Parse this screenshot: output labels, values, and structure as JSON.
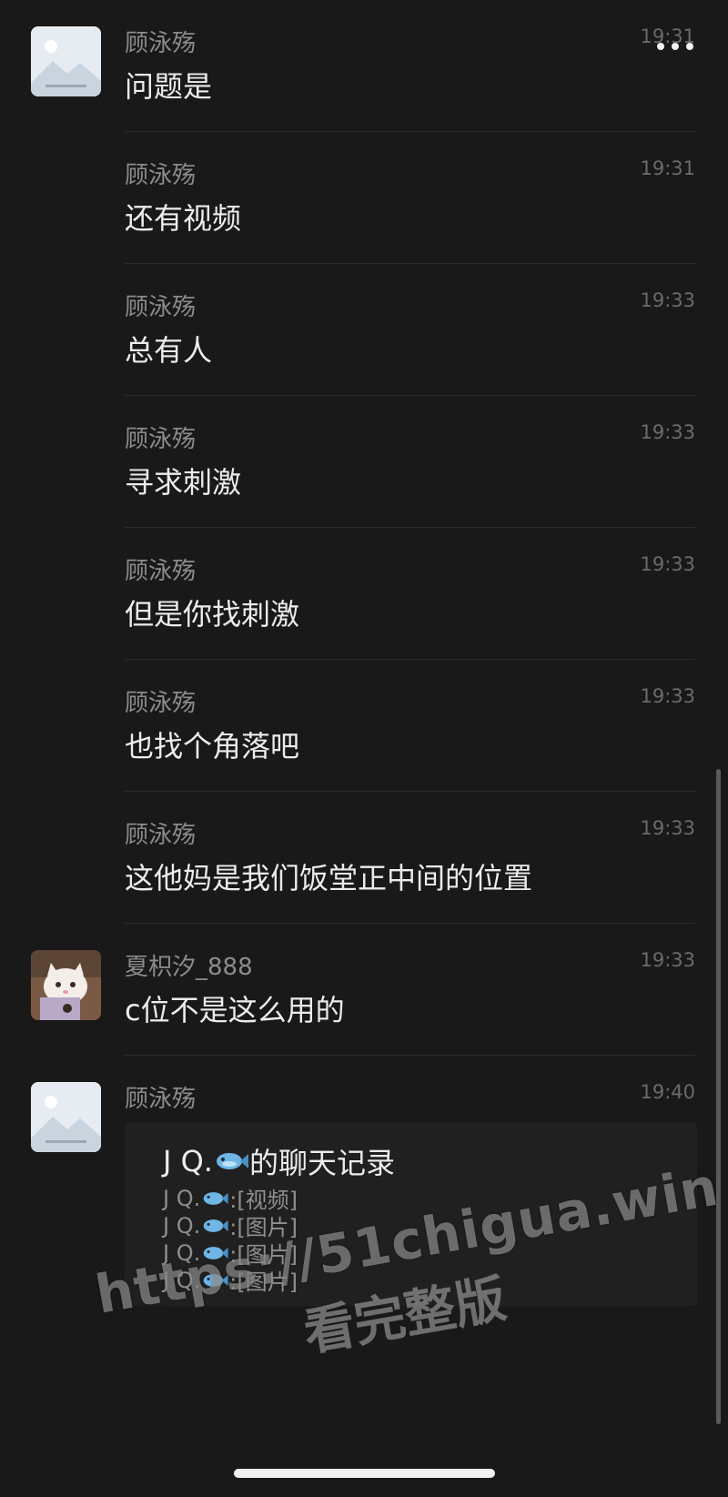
{
  "header": {
    "more_icon": "more-horizontal-icon"
  },
  "messages": [
    {
      "sender": "顾泳殇",
      "time": "19:31",
      "text": "问题是",
      "avatar": "landscape-placeholder"
    },
    {
      "sender": "顾泳殇",
      "time": "19:31",
      "text": "还有视频"
    },
    {
      "sender": "顾泳殇",
      "time": "19:33",
      "text": "总有人"
    },
    {
      "sender": "顾泳殇",
      "time": "19:33",
      "text": "寻求刺激"
    },
    {
      "sender": "顾泳殇",
      "time": "19:33",
      "text": "但是你找刺激"
    },
    {
      "sender": "顾泳殇",
      "time": "19:33",
      "text": "也找个角落吧"
    },
    {
      "sender": "顾泳殇",
      "time": "19:33",
      "text": "这他妈是我们饭堂正中间的位置"
    },
    {
      "sender": "夏枳汐_888",
      "time": "19:33",
      "text": "c位不是这么用的",
      "avatar": "cat-photo"
    },
    {
      "sender": "顾泳殇",
      "time": "19:40",
      "avatar": "landscape-placeholder"
    }
  ],
  "chat_record": {
    "title_prefix": "J Q.",
    "title_suffix": "的聊天记录",
    "icon": "fish-emoji",
    "lines": [
      {
        "name": "J Q.",
        "content": ":[视频]"
      },
      {
        "name": "J Q.",
        "content": ":[图片]"
      },
      {
        "name": "J Q.",
        "content": ":[图片]"
      },
      {
        "name": "J Q.",
        "content": ":[图片]"
      }
    ]
  },
  "watermark": {
    "url": "https://51chigua.win",
    "subtitle": "看完整版"
  }
}
